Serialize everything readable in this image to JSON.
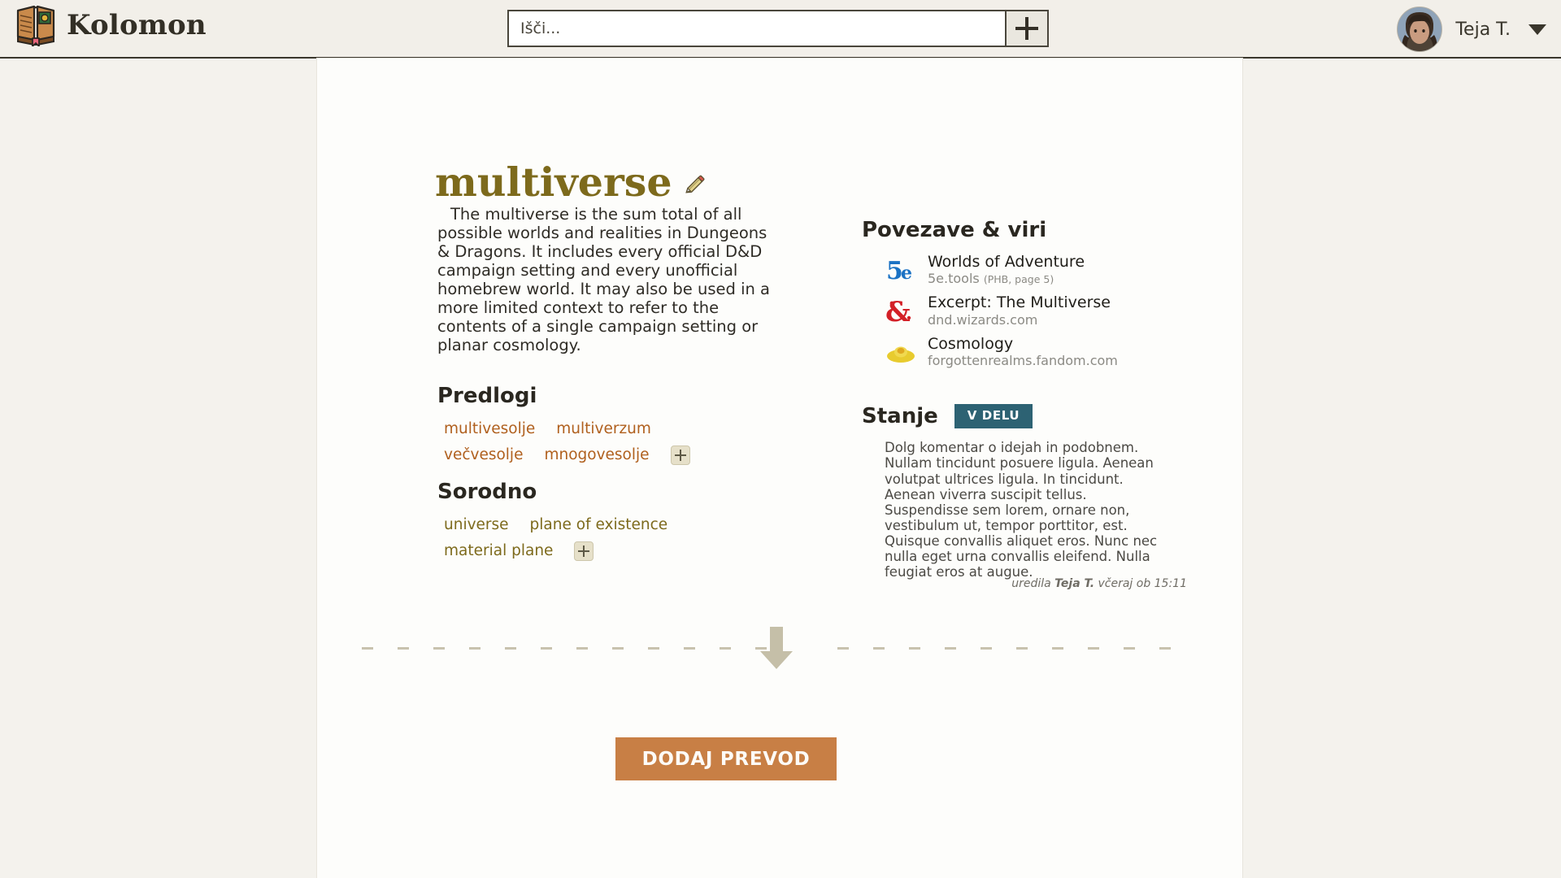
{
  "header": {
    "brand_name": "Kolomon",
    "logo_icon": "open-book-icon",
    "search": {
      "placeholder": "Išči...",
      "value": "",
      "add_button_icon": "plus-icon"
    },
    "user": {
      "name": "Teja T.",
      "avatar_icon": "user-avatar",
      "caret_icon": "chevron-down-icon"
    }
  },
  "article": {
    "title": "multiverse",
    "edit_icon": "pencil-icon",
    "lede": "The multiverse is the sum total of all possible worlds and realities in Dungeons & Dragons. It includes every official D&D campaign setting and every unofficial homebrew world. It may also be used in a more limited context to refer to the contents of a single campaign setting or planar cosmology."
  },
  "suggestions": {
    "heading": "Predlogi",
    "items": [
      "multivesolje",
      "multiverzum",
      "večvesolje",
      "mnogovesolje"
    ],
    "add_icon": "plus-icon"
  },
  "related": {
    "heading": "Sorodno",
    "items": [
      "universe",
      "plane of existence",
      "material plane"
    ],
    "add_icon": "plus-icon"
  },
  "links": {
    "heading": "Povezave & viri",
    "items": [
      {
        "icon": "5e-tools-icon",
        "title": "Worlds of Adventure",
        "source": "5e.tools",
        "note": "(PHB, page 5)"
      },
      {
        "icon": "dnd-ampersand-icon",
        "title": "Excerpt: The Multiverse",
        "source": "dnd.wizards.com",
        "note": ""
      },
      {
        "icon": "forgotten-realms-icon",
        "title": "Cosmology",
        "source": "forgottenrealms.fandom.com",
        "note": ""
      }
    ]
  },
  "status": {
    "heading": "Stanje",
    "badge": "V DELU",
    "badge_color": "#2d6273",
    "comment": "Dolg komentar o idejah in podobnem. Nullam tincidunt posuere ligula. Aenean volutpat ultrices ligula. In tincidunt. Aenean viverra suscipit tellus. Suspendisse sem lorem, ornare non, vestibulum ut, tempor porttitor, est. Quisque convallis aliquet eros. Nunc nec nulla eget urna convallis eleifend. Nulla feugiat eros at augue."
  },
  "edited": {
    "prefix": "uredila ",
    "author": "Teja T.",
    "suffix": " včeraj ob 15:11"
  },
  "divider": {
    "arrow_icon": "arrow-down-icon"
  },
  "cta": {
    "label": "DODAJ PREVOD",
    "color": "#c87f45"
  }
}
